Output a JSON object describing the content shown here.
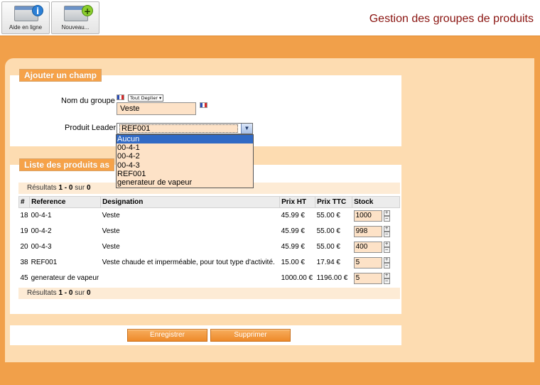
{
  "toolbar": {
    "help_label": "Aide en ligne",
    "new_label": "Nouveau...",
    "help_icon": "info-icon",
    "new_icon": "add-icon"
  },
  "page_title": "Gestion des groupes de produits",
  "add_field": {
    "legend": "Ajouter un champ",
    "group_name_label": "Nom du groupe",
    "lang_selector": "Tout Deplier ▾",
    "group_name_value": "Veste",
    "leader_label": "Produit Leader",
    "leader_value": "REF001",
    "leader_options": [
      "Aucun",
      "00-4-1",
      "00-4-2",
      "00-4-3",
      "REF001",
      "generateur de vapeur"
    ],
    "leader_highlighted": "Aucun"
  },
  "product_list": {
    "legend": "Liste des produits as",
    "results_prefix": "Résultats ",
    "results_range": "1 - 0",
    "results_mid": " sur ",
    "results_total": "0",
    "columns": [
      "#",
      "Reference",
      "Designation",
      "Prix HT",
      "Prix TTC",
      "Stock"
    ],
    "rows": [
      {
        "id": "18",
        "ref": "00-4-1",
        "designation": "Veste",
        "prix_ht": "45.99 €",
        "prix_ttc": "55.00 €",
        "stock": "1000"
      },
      {
        "id": "19",
        "ref": "00-4-2",
        "designation": "Veste",
        "prix_ht": "45.99 €",
        "prix_ttc": "55.00 €",
        "stock": "998"
      },
      {
        "id": "20",
        "ref": "00-4-3",
        "designation": "Veste",
        "prix_ht": "45.99 €",
        "prix_ttc": "55.00 €",
        "stock": "400"
      },
      {
        "id": "38",
        "ref": "REF001",
        "designation": "Veste chaude et imperméable, pour tout type d'activité.",
        "prix_ht": "15.00 €",
        "prix_ttc": "17.94 €",
        "stock": "5"
      },
      {
        "id": "45",
        "ref": "generateur de vapeur",
        "designation": "",
        "prix_ht": "1000.00 €",
        "prix_ttc": "1196.00 €",
        "stock": "5"
      }
    ]
  },
  "actions": {
    "save_label": "Enregistrer",
    "delete_label": "Supprimer"
  },
  "colors": {
    "accent": "#f1a04a",
    "panel": "#fddcb1",
    "title": "#8a1410",
    "selection": "#316ac5"
  }
}
